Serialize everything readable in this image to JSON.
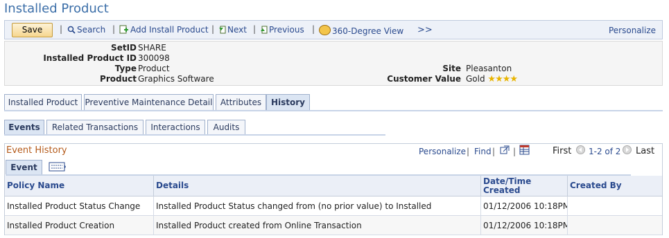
{
  "page": {
    "title": "Installed Product"
  },
  "toolbar": {
    "save_label": "Save",
    "search_label": "Search",
    "add_label": "Add Install Product",
    "next_label": "Next",
    "previous_label": "Previous",
    "view360_label": "360-Degree View",
    "more_label": ">>",
    "personalize_label": "Personalize"
  },
  "header": {
    "setid": {
      "label": "SetID",
      "value": "SHARE"
    },
    "installed_product_id": {
      "label": "Installed Product ID",
      "value": "300098"
    },
    "type": {
      "label": "Type",
      "value": "Product"
    },
    "product": {
      "label": "Product",
      "value": "Graphics Software"
    },
    "site": {
      "label": "Site",
      "value": "Pleasanton"
    },
    "customer_value": {
      "label": "Customer Value",
      "value": "Gold",
      "stars": 4
    }
  },
  "tabs": [
    {
      "label": "Installed Product"
    },
    {
      "label": "Preventive Maintenance Detail"
    },
    {
      "label": "Attributes"
    },
    {
      "label": "History",
      "active": true
    }
  ],
  "subtabs": [
    {
      "label": "Events",
      "active": true
    },
    {
      "label": "Related Transactions"
    },
    {
      "label": "Interactions"
    },
    {
      "label": "Audits"
    }
  ],
  "grid": {
    "title": "Event History",
    "personalize_label": "Personalize",
    "find_label": "Find",
    "first_label": "First",
    "range_label": "1-2 of 2",
    "last_label": "Last",
    "subtab_label": "Event",
    "columns": [
      "Policy Name",
      "Details",
      "Date/Time Created",
      "Created By"
    ],
    "rows": [
      [
        "Installed Product Status Change",
        "Installed Product Status changed from (no prior value) to Installed",
        "01/12/2006 10:18PM",
        ""
      ],
      [
        "Installed Product Creation",
        "Installed Product created from Online Transaction",
        "01/12/2006 10:18PM",
        ""
      ]
    ]
  }
}
